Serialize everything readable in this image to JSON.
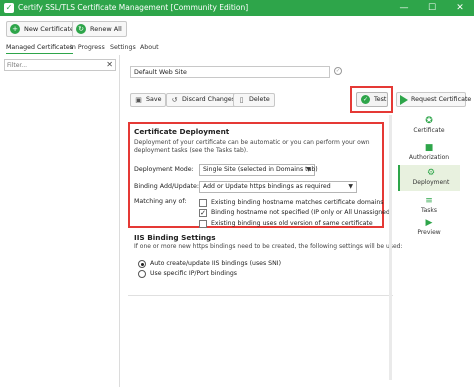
{
  "window": {
    "title": "Certify SSL/TLS Certificate Management [Community Edition]",
    "minimize": "—",
    "maximize": "☐",
    "close": "✕"
  },
  "toolbar": {
    "new_certificate": "New Certificate",
    "renew_all": "Renew All"
  },
  "tabs": [
    "Managed Certificates",
    "In Progress",
    "Settings",
    "About"
  ],
  "filter": {
    "placeholder": "Filter...",
    "value": ""
  },
  "site": {
    "name": "Default Web Site"
  },
  "actions": {
    "save": "Save",
    "discard": "Discard Changes",
    "delete": "Delete",
    "test": "Test",
    "request": "Request Certificate"
  },
  "steps": [
    {
      "label": "Certificate",
      "icon": "certificate-icon"
    },
    {
      "label": "Authorization",
      "icon": "lock-icon"
    },
    {
      "label": "Deployment",
      "icon": "deployment-icon"
    },
    {
      "label": "Tasks",
      "icon": "tasks-icon"
    },
    {
      "label": "Preview",
      "icon": "preview-icon"
    }
  ],
  "deployment": {
    "title": "Certificate Deployment",
    "description": "Deployment of your certificate can be automatic or you can perform your own deployment tasks (see the Tasks tab).",
    "mode_label": "Deployment Mode:",
    "mode_value": "Single Site (selected in Domains tab)",
    "binding_label": "Binding Add/Update:",
    "binding_value": "Add or Update https bindings as required",
    "matching_label": "Matching any of:",
    "options": [
      {
        "label": "Existing binding hostname matches certificate domains",
        "checked": false
      },
      {
        "label": "Binding hostname not specified (IP only or All Unassigned)",
        "checked": true
      },
      {
        "label": "Existing binding uses old version of same certificate",
        "checked": false
      }
    ]
  },
  "iis": {
    "title": "IIS Binding Settings",
    "description": "If one or more new https bindings need to be created, the following settings will be used:",
    "options": [
      {
        "label": "Auto create/update IIS bindings (uses SNI)",
        "selected": true
      },
      {
        "label": "Use specific IP/Port bindings",
        "selected": false
      }
    ]
  },
  "colors": {
    "accent": "#2ea54a",
    "highlight": "#e53935"
  }
}
